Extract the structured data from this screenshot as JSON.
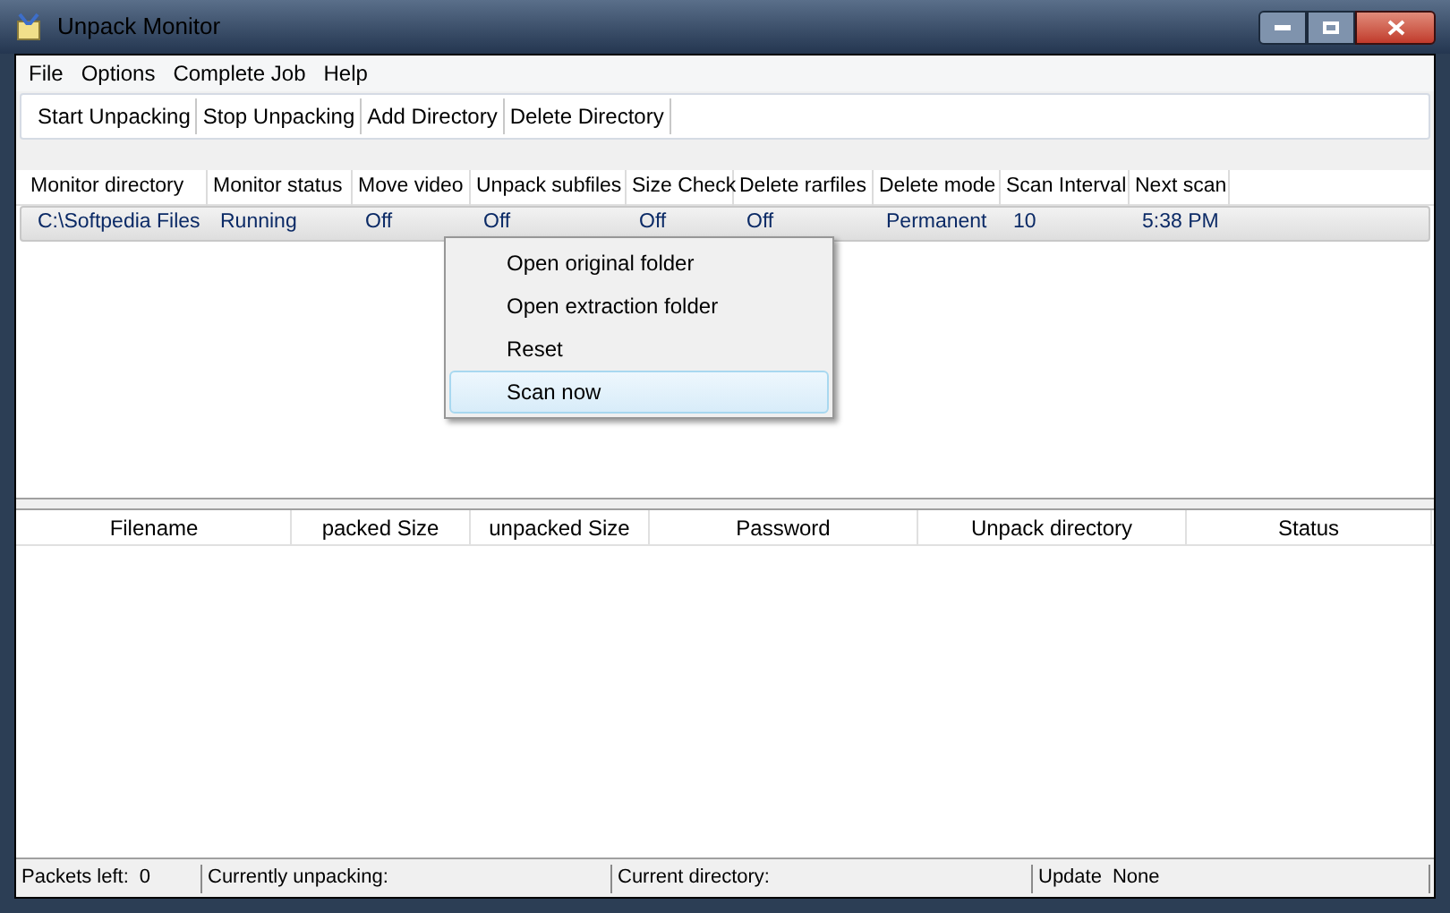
{
  "window": {
    "title": "Unpack Monitor"
  },
  "menu": [
    "File",
    "Options",
    "Complete Job",
    "Help"
  ],
  "toolbar": [
    "Start Unpacking",
    "Stop Unpacking",
    "Add Directory",
    "Delete Directory"
  ],
  "monitor_table": {
    "columns": [
      "Monitor directory",
      "Monitor status",
      "Move video",
      "Unpack subfiles",
      "Size Check",
      "Delete rarfiles",
      "Delete mode",
      "Scan Interval",
      "Next scan"
    ],
    "rows": [
      {
        "selected": true,
        "cells": [
          "C:\\Softpedia Files",
          "Running",
          "Off",
          "Off",
          "Off",
          "Off",
          "Permanent",
          "10",
          "5:38 PM"
        ]
      }
    ]
  },
  "context_menu": [
    {
      "label": "Open original folder",
      "selected": false
    },
    {
      "label": "Open extraction folder",
      "selected": false
    },
    {
      "label": "Reset",
      "selected": false
    },
    {
      "label": "Scan now",
      "selected": true
    }
  ],
  "files_table": {
    "columns": [
      "Filename",
      "packed Size",
      "unpacked Size",
      "Password",
      "Unpack directory",
      "Status"
    ]
  },
  "status_bar": [
    {
      "label": "Packets left:",
      "value": "0"
    },
    {
      "label": "Currently unpacking:"
    },
    {
      "label": "Current directory:"
    },
    {
      "label": "Update",
      "value": "None"
    }
  ]
}
